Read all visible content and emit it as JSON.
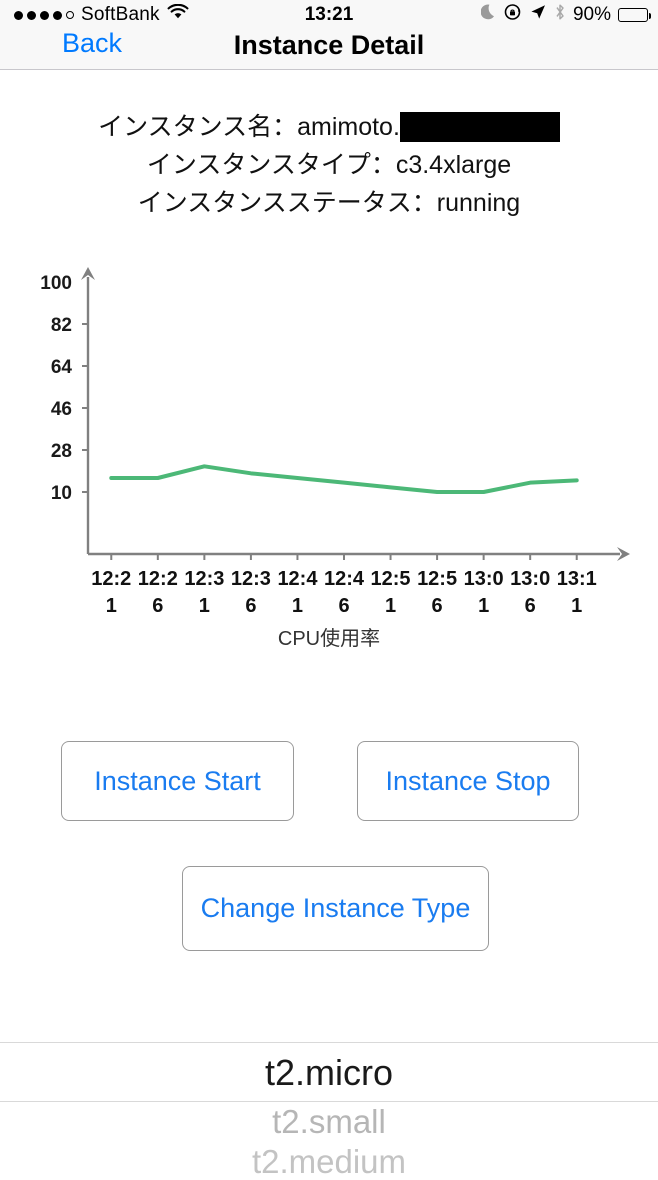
{
  "statusbar": {
    "signal_dots_filled": 4,
    "signal_dots_total": 5,
    "carrier": "SoftBank",
    "wifi_icon": "wifi-icon",
    "time": "13:21",
    "dnd_icon": "moon-icon",
    "rotation_lock_icon": "rotation-lock-icon",
    "location_icon": "location-arrow-icon",
    "bluetooth_icon": "bluetooth-icon",
    "battery_percent": "90%",
    "battery_level": 90
  },
  "navbar": {
    "back_label": "Back",
    "title": "Instance Detail"
  },
  "info": {
    "name_line": "インスタンス名：amimoto.",
    "name_redacted": true,
    "type_line": "インスタンスタイプ：c3.4xlarge",
    "status_line": "インスタンスステータス：running"
  },
  "chart_data": {
    "type": "line",
    "title": "",
    "caption": "CPU使用率",
    "xlabel": "",
    "ylabel": "",
    "line_color": "#4cb877",
    "axis_color": "#808080",
    "grid": false,
    "ylim": [
      0,
      100
    ],
    "yticks": [
      10,
      28,
      46,
      64,
      82,
      100
    ],
    "ytick_labels": [
      "10",
      "28",
      "46",
      "64",
      "82",
      "100"
    ],
    "categories": [
      "12:21",
      "12:26",
      "12:31",
      "12:36",
      "12:41",
      "12:46",
      "12:51",
      "12:56",
      "13:01",
      "13:06",
      "13:11"
    ],
    "series": [
      {
        "name": "CPU使用率",
        "values": [
          16,
          16,
          21,
          18,
          16,
          14,
          12,
          10,
          10,
          14,
          15
        ]
      }
    ]
  },
  "actions": {
    "start_label": "Instance Start",
    "stop_label": "Instance Stop",
    "change_type_label": "Change Instance Type"
  },
  "picker": {
    "selected": "t2.micro",
    "next": "t2.small",
    "after": "t2.medium",
    "options": [
      "t2.micro",
      "t2.small",
      "t2.medium"
    ]
  },
  "colors": {
    "accent_blue": "#007aff",
    "button_blue": "#1a7cf0",
    "chart_green": "#4cb877",
    "bar_bg": "#f8f8f8"
  }
}
